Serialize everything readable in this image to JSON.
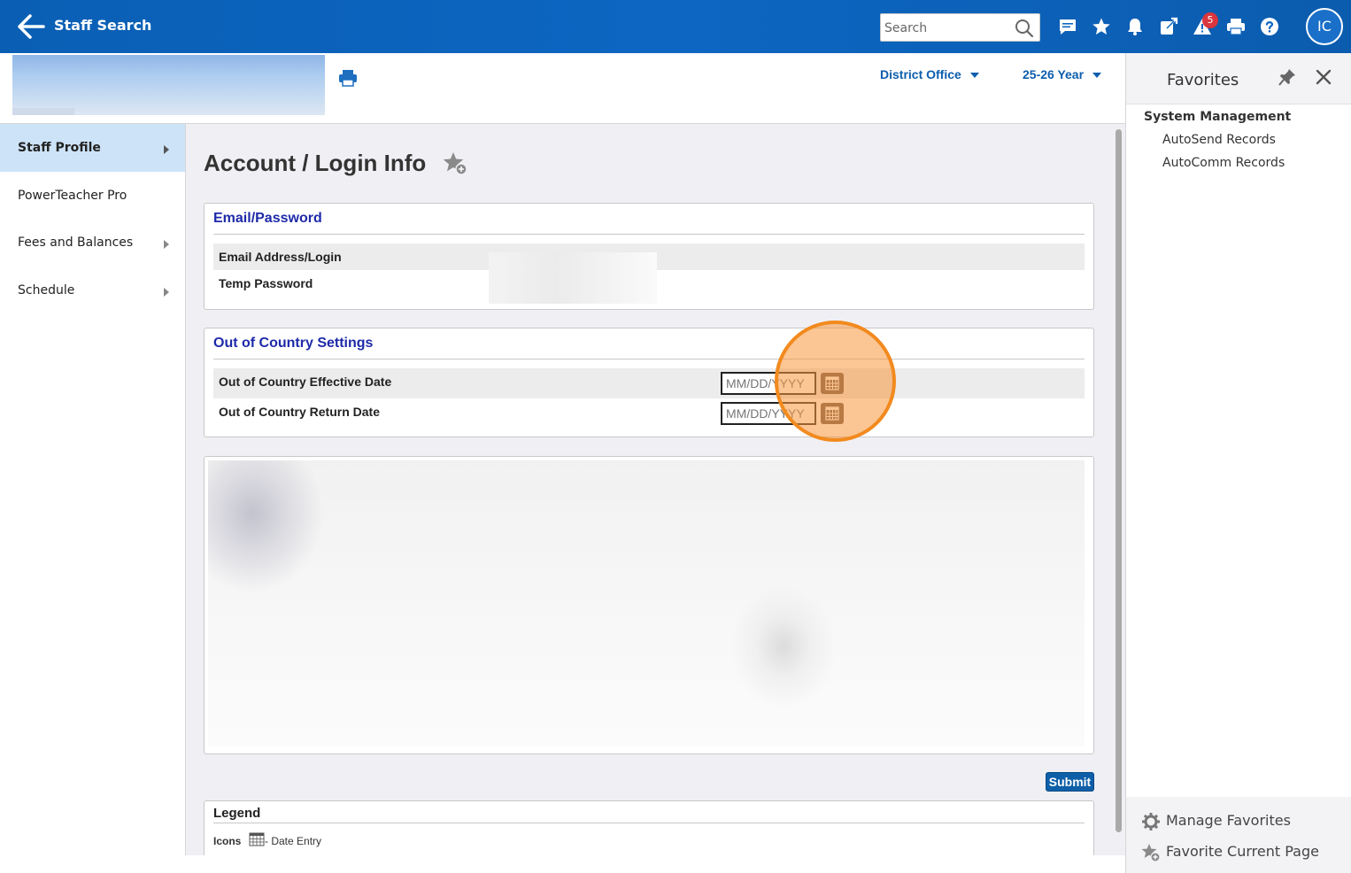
{
  "topbar": {
    "title": "Staff Search",
    "search_placeholder": "Search",
    "alerts_count": "5",
    "avatar_initials": "IC",
    "bg_color": "#0d66c2"
  },
  "header": {
    "school": "District Office",
    "year": "25-26 Year"
  },
  "sidebar": {
    "items": [
      {
        "label": "Staff Profile",
        "active": true,
        "has_submenu": true
      },
      {
        "label": "PowerTeacher Pro",
        "active": false,
        "has_submenu": false
      },
      {
        "label": "Fees and Balances",
        "active": false,
        "has_submenu": true
      },
      {
        "label": "Schedule",
        "active": false,
        "has_submenu": true
      }
    ]
  },
  "main": {
    "page_title": "Account / Login Info",
    "email_section": {
      "title": "Email/Password",
      "rows": [
        {
          "label": "Email Address/Login"
        },
        {
          "label": "Temp Password"
        }
      ]
    },
    "country_section": {
      "title": "Out of Country Settings",
      "rows": [
        {
          "label": "Out of Country Effective Date",
          "placeholder": "MM/DD/YYYY"
        },
        {
          "label": "Out of Country Return Date",
          "placeholder": "MM/DD/YYYY"
        }
      ]
    },
    "submit_label": "Submit",
    "legend": {
      "title": "Legend",
      "icons_label": "Icons",
      "date_entry": "- Date Entry"
    }
  },
  "favorites": {
    "title": "Favorites",
    "group": "System Management",
    "links": [
      "AutoSend Records",
      "AutoComm Records"
    ],
    "manage_label": "Manage Favorites",
    "favorite_current_label": "Favorite Current Page"
  },
  "colors": {
    "accent": "#0c5dad",
    "section_title": "#1e2aa8",
    "active_nav": "#cde3f8",
    "highlight": "#f28a1e"
  }
}
